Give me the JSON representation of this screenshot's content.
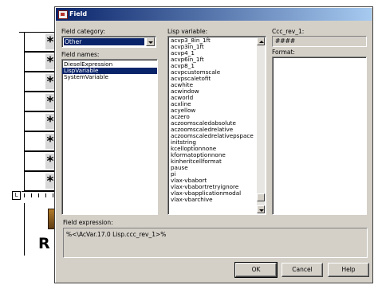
{
  "dialog": {
    "title": "Field",
    "field_category_label": "Field category:",
    "field_category_value": "Other",
    "field_names_label": "Field names:",
    "field_names": [
      {
        "label": "DieselExpression",
        "selected": false
      },
      {
        "label": "LispVariable",
        "selected": true
      },
      {
        "label": "SystemVariable",
        "selected": false
      }
    ],
    "lisp_variable_label": "Lisp variable:",
    "lisp_variables": [
      "acvp3_8in_1ft",
      "acvp3in_1ft",
      "acvp4_1",
      "acvp6in_1ft",
      "acvp8_1",
      "acvpcustomscale",
      "acvpscaletofit",
      "acwhite",
      "acwindow",
      "acworld",
      "acxline",
      "acyellow",
      "aczero",
      "aczoomscaledabsolute",
      "aczoomscaledrelative",
      "aczoomscaledrelativepspace",
      "initstring",
      "kcelloptionnone",
      "kformatoptionnone",
      "kinheritcellformat",
      "pause",
      "pi",
      "vlax-vbabort",
      "vlax-vbabortretryignore",
      "vlax-vbapplicationmodal",
      "vlax-vbarchive"
    ],
    "preview_label": "Ccc_rev_1:",
    "preview_value": "####",
    "format_label": "Format:",
    "expression_label": "Field expression:",
    "expression_value": "%<\\AcVar.17.0 Lisp.ccc_rev_1>%",
    "ok_label": "OK",
    "cancel_label": "Cancel",
    "help_label": "Help"
  },
  "background": {
    "row_glyph": "*",
    "ruler_label": "L",
    "big_letter": "R"
  }
}
